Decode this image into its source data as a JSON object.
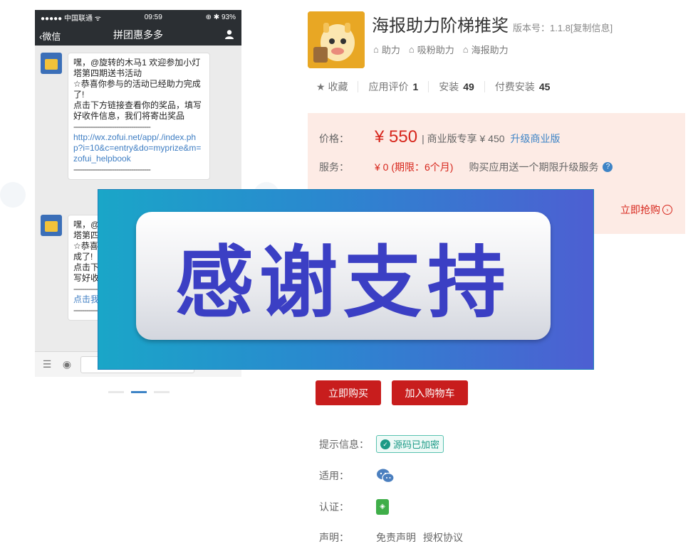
{
  "phone": {
    "status": {
      "carrier": "●●●●● 中国联通 ᯤ",
      "time": "09:59",
      "battery": "⊕ ✱ 93%"
    },
    "nav": {
      "back_label": "微信",
      "title": "拼团惠多多"
    },
    "message1": {
      "lines": [
        "嘿，@旋转的木马1 欢迎参加小灯塔第四期送书活动",
        "☆恭喜你参与的活动已经助力完成了!",
        "点击下方链接查看你的奖品，填写好收件信息，我们将寄出奖品"
      ],
      "dash": "------------------------------------",
      "link": "http://wx.zofui.net/app/./index.php?i=10&c=entry&do=myprize&m=zofui_helpbook"
    },
    "message2": {
      "lines": [
        "嘿，@",
        "塔第四",
        "☆恭喜",
        "成了!",
        "点击下",
        "写好收"
      ],
      "link": "点击我"
    }
  },
  "app": {
    "title": "海报助力阶梯推奖",
    "version": "版本号：1.1.8[复制信息]",
    "tags": [
      "助力",
      "吸粉助力",
      "海报助力"
    ],
    "stats": {
      "favorite": "收藏",
      "rating_label": "应用评价",
      "rating_value": "1",
      "install_label": "安装",
      "install_value": "49",
      "paid_label": "付费安装",
      "paid_value": "45"
    }
  },
  "pricing": {
    "price_label": "价格：",
    "price": "¥ 550",
    "biz": "| 商业版专享 ¥ 450",
    "upgrade": "升级商业版",
    "service_label": "服务：",
    "service_price": "¥ 0 (期限：6个月)",
    "service_note": "购买应用送一个期限升级服务",
    "rush": "立即抢购"
  },
  "buttons": {
    "buy": "立即购买",
    "cart": "加入购物车"
  },
  "info": {
    "hint_label": "提示信息：",
    "hint_value": "源码已加密",
    "apply_label": "适用：",
    "cert_label": "认证：",
    "decl_label": "声明：",
    "decl_links": [
      "免责声明",
      "授权协议"
    ]
  },
  "banner": {
    "text": "感谢支持"
  },
  "colors": {
    "accent_red": "#c81d1d",
    "link_blue": "#3e84c6",
    "banner_text": "#3b3fc4"
  }
}
